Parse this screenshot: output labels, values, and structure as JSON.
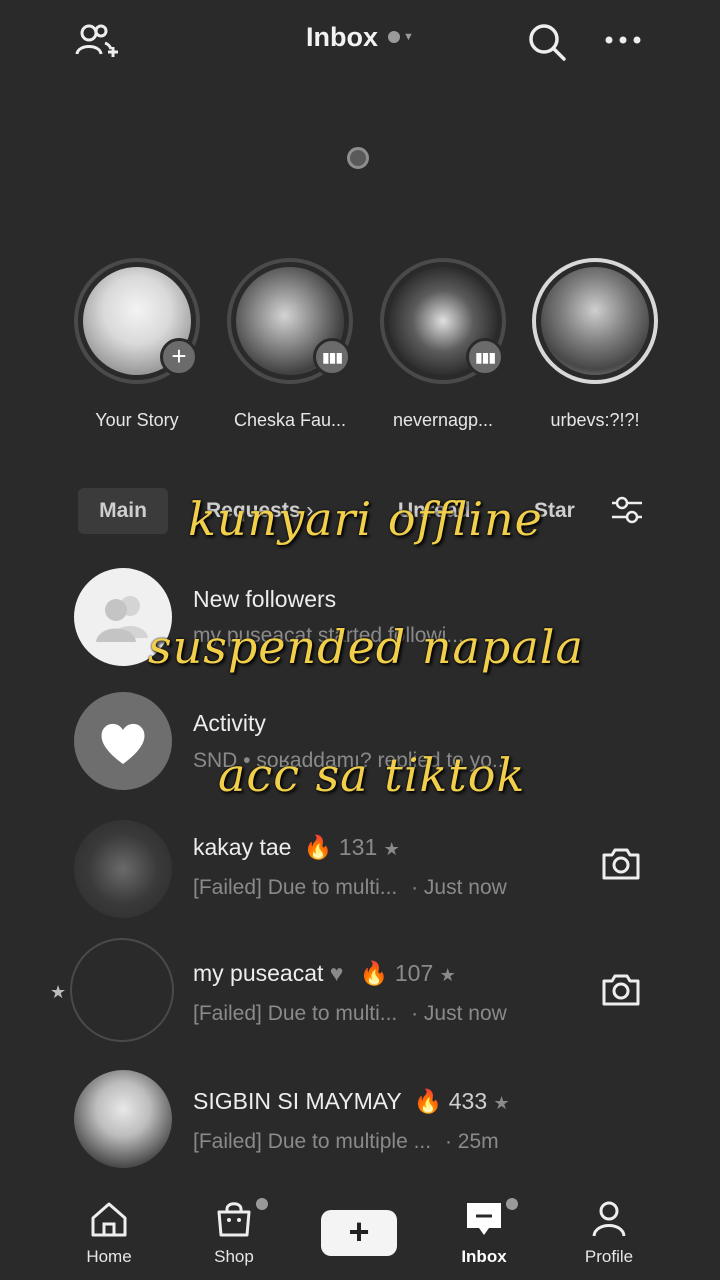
{
  "header": {
    "title": "Inbox"
  },
  "stories": [
    {
      "name": "Your Story",
      "badge": "+"
    },
    {
      "name": "Cheska Fau...",
      "badge": "▮▮▮"
    },
    {
      "name": "nevernagp...",
      "badge": "▮▮▮"
    },
    {
      "name": "urbevs:?!?!",
      "badge": ""
    }
  ],
  "tabs": {
    "main": "Main",
    "requests": "Requests",
    "requests_chevron": "›",
    "unread": "Unread",
    "starred": "Star"
  },
  "rows": [
    {
      "title": "New followers",
      "subtitle": "my puseacat started followi..."
    },
    {
      "title": "Activity",
      "subtitle": "SND • soʁaddamı?  replied to yo..."
    },
    {
      "title": "kakay tae",
      "streak": "131",
      "preview": "[Failed] Due to multi...",
      "time": "· Just now"
    },
    {
      "title": "my puseacat",
      "heart": "♥",
      "streak": "107",
      "preview": "[Failed] Due to multi...",
      "time": "· Just now"
    },
    {
      "title": "SIGBIN SI MAYMAY",
      "streak": "433",
      "preview": "[Failed] Due to multiple ...",
      "time": "· 25m"
    }
  ],
  "overlay": {
    "line1": "kunyari offline",
    "line2": "suspended napala",
    "line3": "acc sa tiktok"
  },
  "nav": {
    "home": "Home",
    "shop": "Shop",
    "create": "+",
    "inbox": "Inbox",
    "profile": "Profile"
  },
  "colors": {
    "background": "#2a2a2a",
    "caption": "#f1cf4a",
    "muted_text": "#8a8a8a"
  }
}
